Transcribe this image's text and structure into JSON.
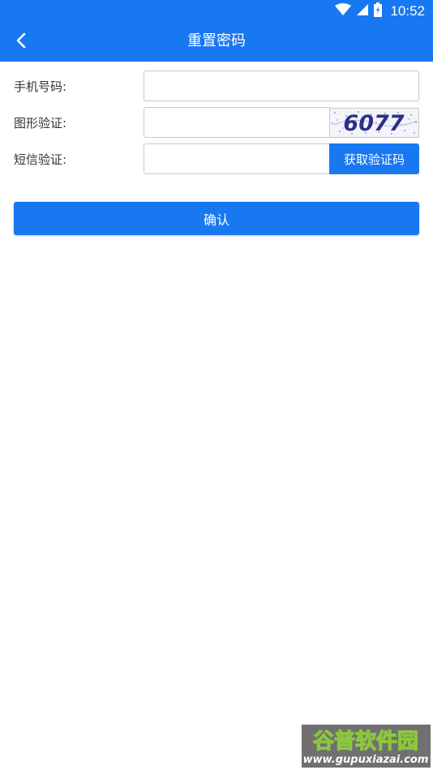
{
  "status_bar": {
    "time": "10:52",
    "icons": [
      "wifi-icon",
      "cell-signal-icon",
      "battery-icon"
    ]
  },
  "header": {
    "title": "重置密码",
    "back_icon": "chevron-left-icon"
  },
  "form": {
    "phone_label": "手机号码:",
    "phone_value": "",
    "captcha_label": "图形验证:",
    "captcha_value": "",
    "captcha_image_text": "6077",
    "sms_label": "短信验证:",
    "sms_value": "",
    "sms_button_label": "获取验证码"
  },
  "confirm_label": "确认",
  "watermark": {
    "brand": "谷普软件园",
    "url": "www.gupuxiazai.com"
  },
  "colors": {
    "primary": "#1878f2",
    "input_border": "#c8c8c8",
    "label_text": "#333333",
    "captcha_text": "#2d2f8a"
  }
}
